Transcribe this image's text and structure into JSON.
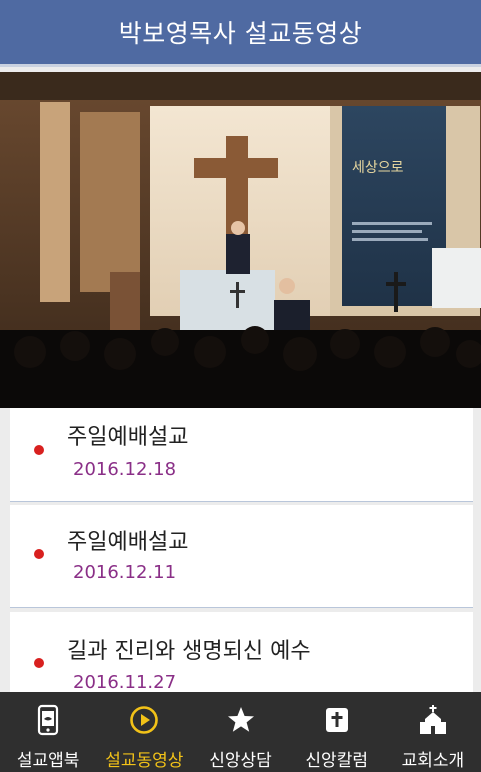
{
  "header": {
    "title": "박보영목사 설교동영상"
  },
  "sermons": [
    {
      "title": "주일예배설교",
      "date": "2016.12.18"
    },
    {
      "title": "주일예배설교",
      "date": "2016.12.11"
    },
    {
      "title": "길과 진리와 생명되신 예수",
      "date": "2016.11.27"
    }
  ],
  "tabs": [
    {
      "label": "설교앱북",
      "icon": "phone-book-icon",
      "active": false
    },
    {
      "label": "설교동영상",
      "icon": "play-icon",
      "active": true
    },
    {
      "label": "신앙상담",
      "icon": "star-icon",
      "active": false
    },
    {
      "label": "신앙칼럼",
      "icon": "scroll-cross-icon",
      "active": false
    },
    {
      "label": "교회소개",
      "icon": "church-icon",
      "active": false
    }
  ],
  "colors": {
    "header": "#4f6aa2",
    "tabbar": "#2f2f2f",
    "active_tab": "#f2c218",
    "bullet": "#d8201f",
    "date": "#8a2f87"
  }
}
